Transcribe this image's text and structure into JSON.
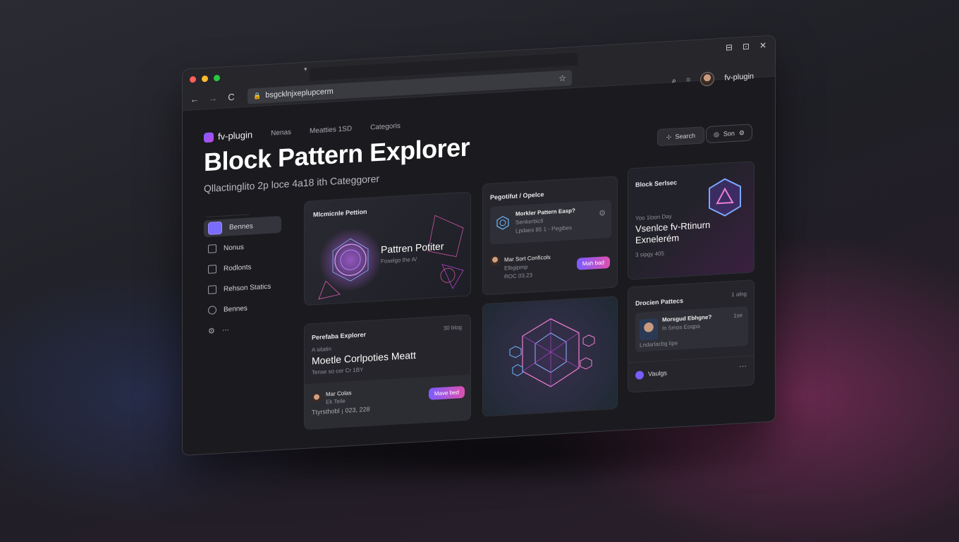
{
  "browser": {
    "url": "bsgcklnjxeplupcerm",
    "nav_back": "←",
    "nav_forward": "→",
    "nav_reload": "C",
    "nav_more": "⋮",
    "lock": "🔒",
    "star": "☆",
    "win_controls": [
      "⊟",
      "⊡",
      "✕"
    ],
    "account_name": "fv-plugin"
  },
  "app": {
    "brand": "fv-plugin",
    "nav": [
      "Nenas",
      "Meatties 1SD",
      "Categoris"
    ],
    "title": "Block Pattern Explorer",
    "subtitle": "Qllactinglito 2p loce 4a18 ith Categgorer",
    "search_label": "Search",
    "sort_label": "Son"
  },
  "sidebar": {
    "items": [
      {
        "label": "Bennes",
        "active": true
      },
      {
        "label": "Nonus"
      },
      {
        "label": "Rodlonts"
      },
      {
        "label": "Rehson Statics"
      },
      {
        "label": "Bennes"
      },
      {
        "label": "···"
      }
    ]
  },
  "cards": {
    "c1": {
      "title": "Mlcmicnle Pettion",
      "headline": "Pattren Potiter",
      "sub": "Foselgo the A/"
    },
    "c2": {
      "title": "Pegotifut / Opelce",
      "inner_title": "Morkler Pattern Easp?",
      "inner_sub1": "Senkerbicll",
      "inner_sub2": "Lpdaes 85 1 - Pegibes",
      "row_title": "Mar Sort Conficols",
      "row_sub1": "Elbgipmp",
      "row_sub2": "ROC 03.23",
      "button": "Mah bad"
    },
    "c3": {
      "title": "Block Serlsec",
      "tag": "Yoo 1loon Day",
      "headline": "Vsenlce fv-Rtinurn Exnelerém",
      "sub": "3 sipgy 405"
    },
    "c4": {
      "title": "Perefaba Explorer",
      "meta": "30 blog",
      "sub": "A sitatin",
      "headline": "Moetle Corlpoties Meatt",
      "sub2": "Tense so cor Cr 1BY",
      "author": "Mar Colas",
      "author_sub": "Ek Teile",
      "date": "Ttyrsthobl ¡ 023, 228",
      "button": "Mave bed"
    },
    "c6": {
      "title": "Drocien Pattecs",
      "meta": "1 alng",
      "inner_title": "Morsgud Ebhgne?",
      "inner_sub": "In 5mos Eoqpa",
      "inner_meta": "1se",
      "inner_foot": "Lndarlacbg lipe",
      "footer_label": "Vaulgs",
      "footer_more": "···"
    }
  },
  "colors": {
    "accent": "#7b5cff",
    "accent2": "#e04fb0"
  }
}
